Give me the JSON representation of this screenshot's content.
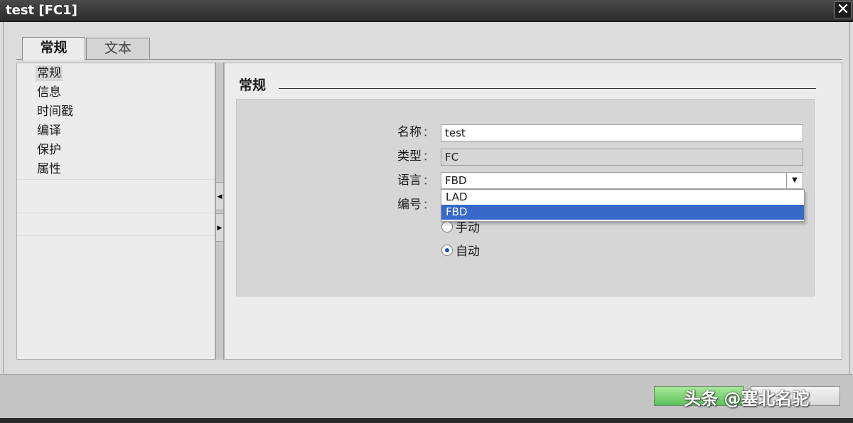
{
  "window": {
    "title": "test [FC1]",
    "close_symbol": "✕"
  },
  "tabs": [
    {
      "label": "常规",
      "active": true
    },
    {
      "label": "文本",
      "active": false
    }
  ],
  "nav": {
    "items": [
      {
        "label": "常规",
        "selected": true
      },
      {
        "label": "信息",
        "selected": false
      },
      {
        "label": "时间戳",
        "selected": false
      },
      {
        "label": "编译",
        "selected": false
      },
      {
        "label": "保护",
        "selected": false
      },
      {
        "label": "属性",
        "selected": false
      }
    ]
  },
  "section": {
    "title": "常规"
  },
  "form": {
    "colon": "：",
    "name": {
      "label": "名称",
      "value": "test"
    },
    "type": {
      "label": "类型",
      "value": "FC"
    },
    "language": {
      "label": "语言",
      "value": "FBD",
      "options": [
        "LAD",
        "FBD"
      ],
      "highlighted": "FBD"
    },
    "number": {
      "label": "编号",
      "radios": [
        {
          "label": "手动",
          "checked": false
        },
        {
          "label": "自动",
          "checked": true
        }
      ]
    }
  },
  "footer": {
    "watermark": "头条 @塞北名驼"
  },
  "colors": {
    "titlebar": "#2c2c2c",
    "highlight": "#3669c9",
    "ok_button": "#5cc25a"
  }
}
